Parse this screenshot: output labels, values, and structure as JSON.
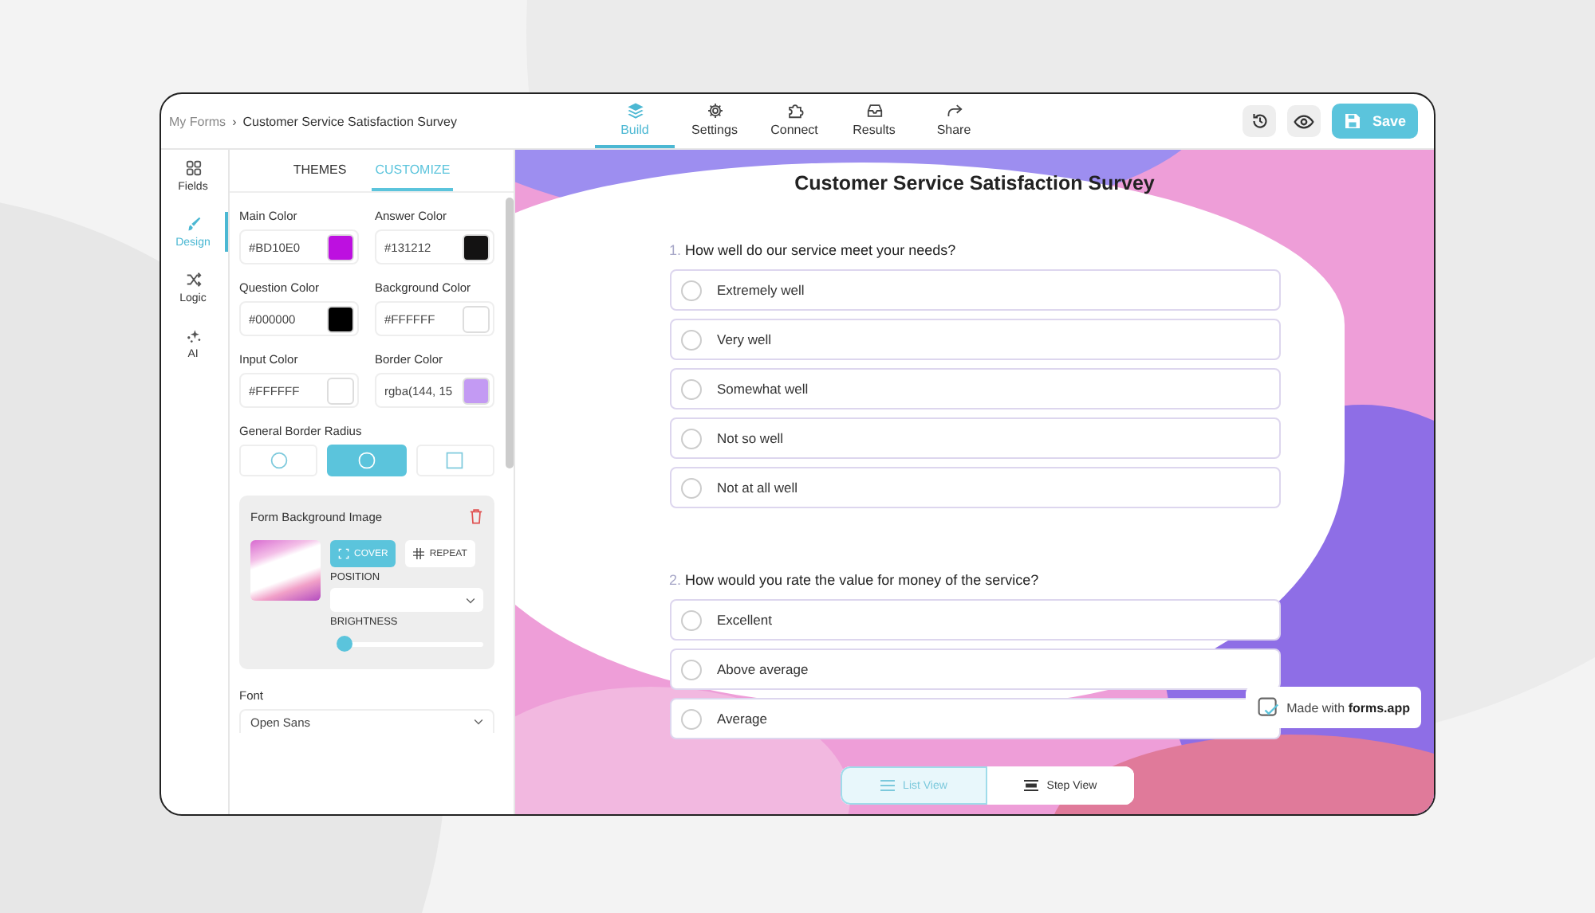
{
  "breadcrumb": {
    "parent": "My Forms",
    "separator": "›",
    "current": "Customer Service Satisfaction Survey"
  },
  "nav": [
    {
      "label": "Build",
      "kind": "layers",
      "selected": true
    },
    {
      "label": "Settings",
      "kind": "gear",
      "selected": false
    },
    {
      "label": "Connect",
      "kind": "puzzle",
      "selected": false
    },
    {
      "label": "Results",
      "kind": "inbox",
      "selected": false
    },
    {
      "label": "Share",
      "kind": "share",
      "selected": false
    }
  ],
  "save_button": "Save",
  "rail": [
    {
      "label": "Fields",
      "kind": "grid",
      "selected": false
    },
    {
      "label": "Design",
      "kind": "brush",
      "selected": true
    },
    {
      "label": "Logic",
      "kind": "shuffle",
      "selected": false
    },
    {
      "label": "AI",
      "kind": "sparkle",
      "selected": false
    }
  ],
  "panel_tabs": [
    {
      "label": "THEMES",
      "selected": false
    },
    {
      "label": "CUSTOMIZE",
      "selected": true
    }
  ],
  "colors": [
    {
      "label": "Main Color",
      "value": "#BD10E0",
      "color": "#bd10e0"
    },
    {
      "label": "Answer Color",
      "value": "#131212",
      "color": "#131212"
    },
    {
      "label": "Question Color",
      "value": "#000000",
      "color": "#000000"
    },
    {
      "label": "Background Color",
      "value": "#FFFFFF",
      "color": "#ffffff"
    },
    {
      "label": "Input Color",
      "value": "#FFFFFF",
      "color": "#ffffff"
    },
    {
      "label": "Border Color",
      "value": "rgba(144, 15",
      "color": "#c39af3"
    }
  ],
  "border_radius": {
    "label": "General Border Radius",
    "options": [
      {
        "kind": "circle",
        "selected": false
      },
      {
        "kind": "rounded",
        "selected": true
      },
      {
        "kind": "square",
        "selected": false
      }
    ]
  },
  "background_image": {
    "title": "Form Background Image",
    "fit": [
      {
        "label": "COVER",
        "kind": "cover",
        "selected": true
      },
      {
        "label": "REPEAT",
        "kind": "repeat",
        "selected": false
      }
    ],
    "position_label": "POSITION",
    "brightness_label": "BRIGHTNESS",
    "brightness": {
      "level": 0.05
    }
  },
  "font": {
    "label": "Font",
    "value": "Open Sans"
  },
  "form": {
    "title": "Customer Service Satisfaction Survey",
    "questions": [
      {
        "number": "1.",
        "text": "How well do our service meet your needs?",
        "options": [
          "Extremely well",
          "Very well",
          "Somewhat well",
          "Not so well",
          "Not at all well"
        ]
      },
      {
        "number": "2.",
        "text": "How would you rate the value for money of the service?",
        "options": [
          "Excellent",
          "Above average",
          "Average"
        ]
      }
    ]
  },
  "badge": {
    "prefix": "Made with",
    "brand": "forms.app"
  },
  "view_toggle": [
    {
      "label": "List View",
      "kind": "list",
      "selected": true
    },
    {
      "label": "Step View",
      "kind": "steps",
      "selected": false
    }
  ]
}
